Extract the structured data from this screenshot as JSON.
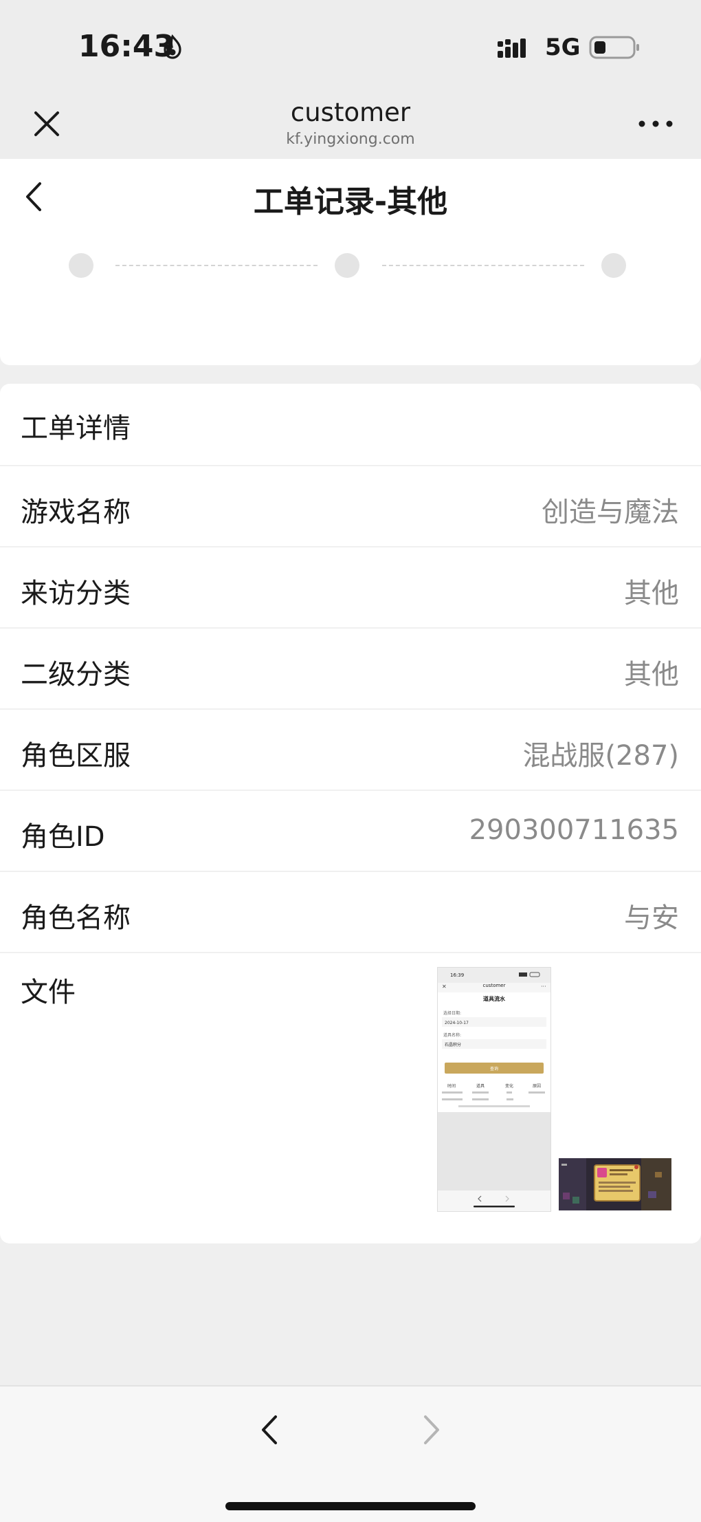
{
  "status_bar": {
    "time": "16:43",
    "network": "5G"
  },
  "browser": {
    "title": "customer",
    "url": "kf.yingxiong.com"
  },
  "page": {
    "title": "工单记录-其他"
  },
  "details": {
    "section_title": "工单详情",
    "rows": [
      {
        "label": "游戏名称",
        "value": "创造与魔法"
      },
      {
        "label": "来访分类",
        "value": "其他"
      },
      {
        "label": "二级分类",
        "value": "其他"
      },
      {
        "label": "角色区服",
        "value": "混战服(287)"
      },
      {
        "label": "角色ID",
        "value": "290300711635"
      },
      {
        "label": "角色名称",
        "value": "与安"
      }
    ],
    "file_label": "文件"
  },
  "thumbnail1": {
    "time": "16:39",
    "title": "customer",
    "page_title": "道具流水",
    "field1_label": "选择日期:",
    "field1_value": "2024-10-17",
    "field2_label": "道具名称:",
    "field2_value": "石晶积分",
    "button": "查询",
    "columns": [
      "时间",
      "道具",
      "变化",
      "原因"
    ]
  },
  "colors": {
    "page_bg": "#efefef",
    "card_bg": "#ffffff",
    "value_text": "#8a8a8a",
    "accent_gold": "#c9a75c"
  }
}
